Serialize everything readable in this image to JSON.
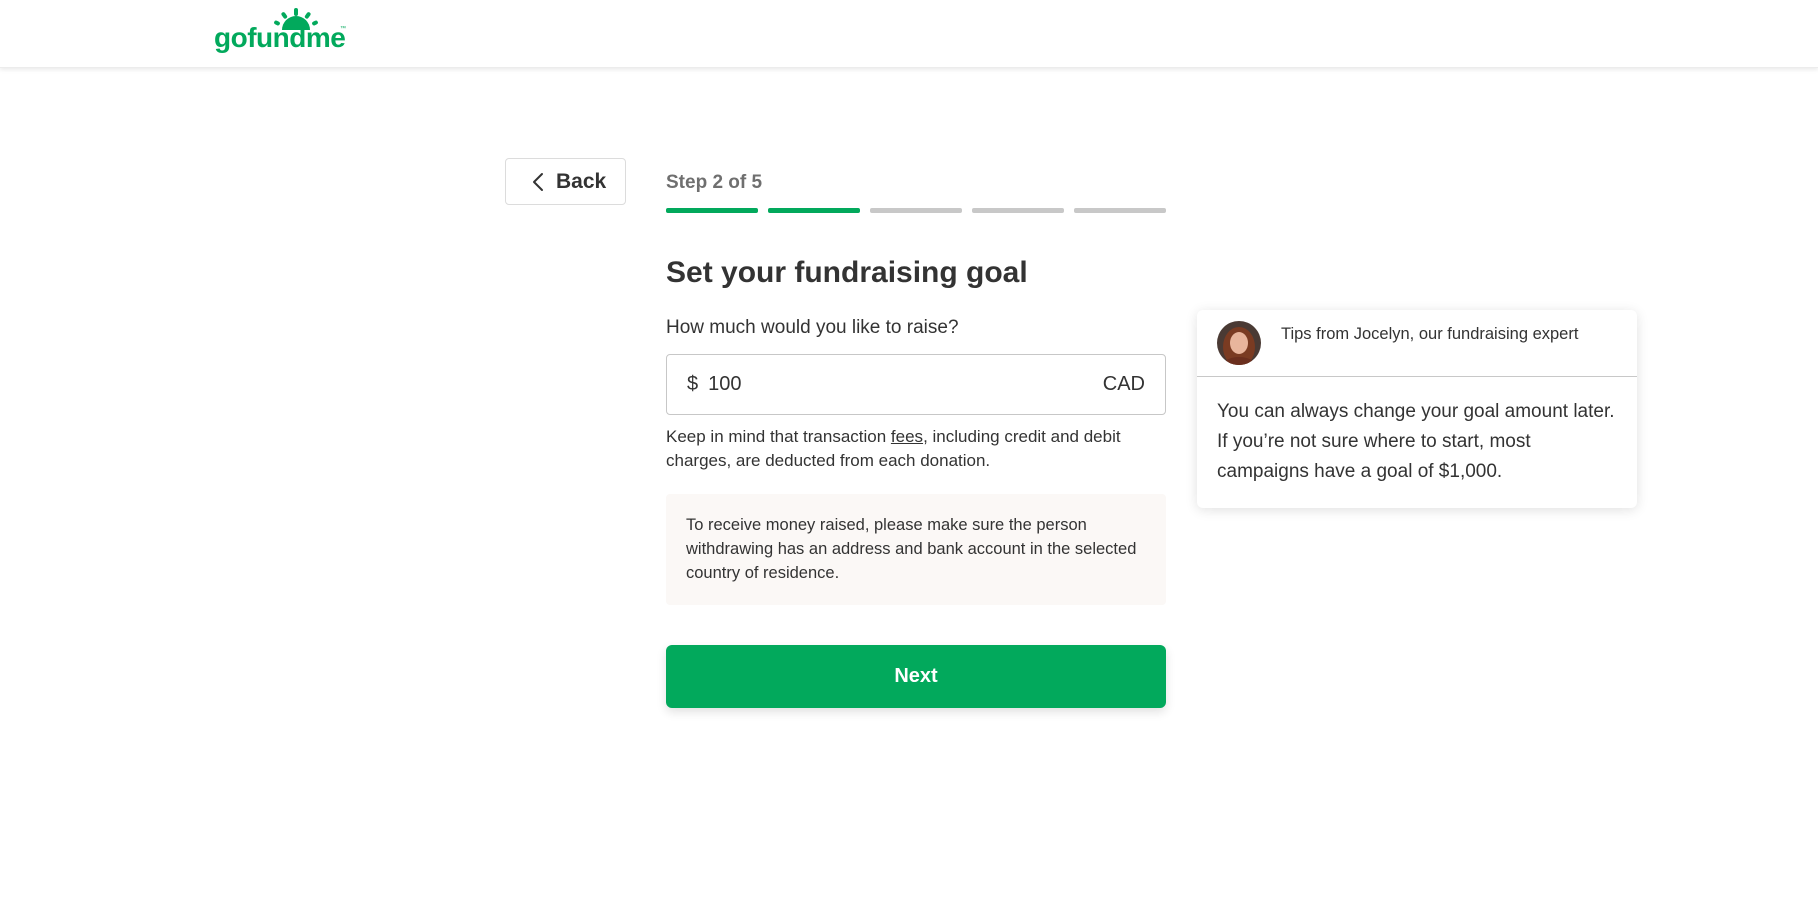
{
  "brand": {
    "logo_text": "gofundme",
    "trademark": "™",
    "color": "#02a95c"
  },
  "nav": {
    "back_label": "Back",
    "back_icon": "chevron-left-icon"
  },
  "progress": {
    "step_text": "Step 2 of 5",
    "current_step": 2,
    "total_steps": 5
  },
  "form": {
    "title": "Set your fundraising goal",
    "question": "How much would you like to raise?",
    "currency_symbol": "$",
    "amount_value": "100",
    "currency_code": "CAD",
    "fee_note_before": "Keep in mind that transaction ",
    "fee_link": "fees",
    "fee_note_after": ", including credit and debit charges, are deducted from each donation.",
    "notice": "To receive money raised, please make sure the person withdrawing has an address and bank account in the selected country of residence.",
    "next_label": "Next"
  },
  "tips": {
    "title": "Tips from Jocelyn, our fundraising expert",
    "body": "You can always change your goal amount later. If you’re not sure where to start, most campaigns have a goal of $1,000."
  }
}
